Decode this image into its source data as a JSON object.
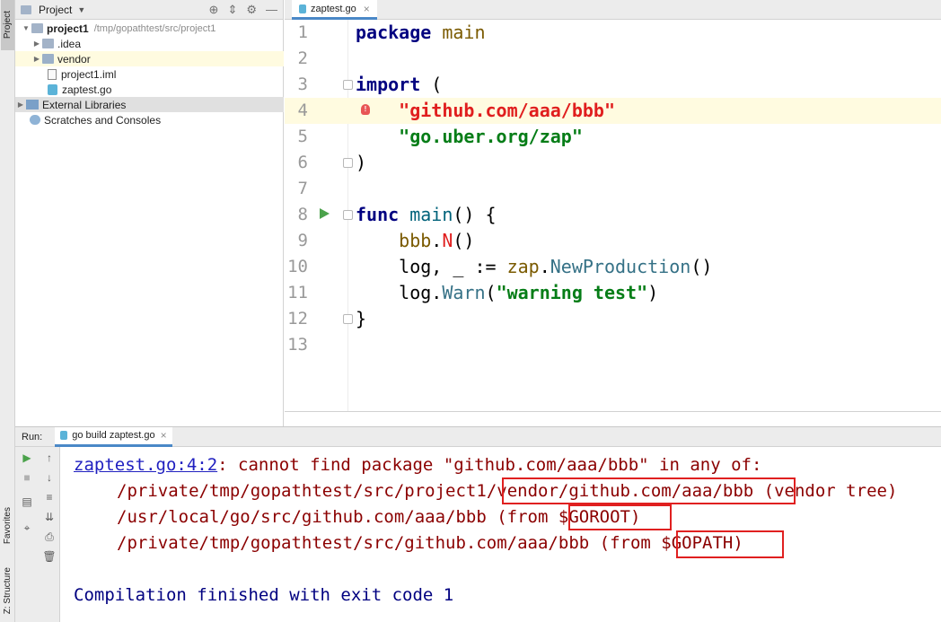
{
  "left_strip": {
    "project_tab": "Project",
    "favorites_tab": "Favorites",
    "structure_tab": "Z: Structure"
  },
  "project_panel": {
    "title": "Project",
    "tree": {
      "root_name": "project1",
      "root_path": "/tmp/gopathtest/src/project1",
      "idea": ".idea",
      "vendor": "vendor",
      "iml": "project1.iml",
      "go_file": "zaptest.go",
      "external_libraries": "External Libraries",
      "scratches": "Scratches and Consoles"
    }
  },
  "editor": {
    "tab_label": "zaptest.go",
    "line_numbers": [
      "1",
      "2",
      "3",
      "4",
      "5",
      "6",
      "7",
      "8",
      "9",
      "10",
      "11",
      "12",
      "13"
    ],
    "code": {
      "l1_kw": "package",
      "l1_name": "main",
      "l3_kw": "import",
      "l3_paren": " (",
      "l4_str": "\"github.com/aaa/bbb\"",
      "l5_str": "\"go.uber.org/zap\"",
      "l6": ")",
      "l8_kw": "func",
      "l8_name": "main",
      "l8_rest": "() {",
      "l9_pkg": "bbb",
      "l9_dot": ".",
      "l9_fn": "N",
      "l9_rest": "()",
      "l10_pre": "log, _ := ",
      "l10_pkg": "zap",
      "l10_dot": ".",
      "l10_fn": "NewProduction",
      "l10_rest": "()",
      "l11_pre": "log.",
      "l11_fn": "Warn",
      "l11_open": "(",
      "l11_str": "\"warning test\"",
      "l11_close": ")",
      "l12": "}"
    }
  },
  "run_panel": {
    "label": "Run:",
    "tab_label": "go build zaptest.go",
    "console": {
      "link": "zaptest.go:4:2",
      "msg": ": cannot find package \"github.com/aaa/bbb\" in any of:",
      "p1_a": "/private/tmp/gopathtest/src/project1",
      "p1_b": "/vendor/github.com/aaa/bbb",
      "p1_c": " (vendor tree)",
      "p2_a": "/usr/local/go/src/github.com/aaa/bbb (from ",
      "p2_b": "$GOROOT)",
      "p3_a": "/private/tmp/gopathtest/src/github.com/aaa/bbb (from ",
      "p3_b": "$GOPATH)",
      "done": "Compilation finished with exit code 1"
    }
  },
  "colors": {
    "keyword": "#000080",
    "string": "#067d17",
    "error": "#e01e1e",
    "console_error": "#8b0000",
    "highlight_line": "#fffbe0",
    "tab_underline": "#4a88c7"
  },
  "icons": [
    "folder-icon",
    "go-file-icon",
    "module-icon",
    "run-icon",
    "stop-icon",
    "rerun-icon",
    "scroll-icon",
    "print-icon",
    "trash-icon",
    "gear-icon",
    "collapse-icon",
    "target-icon",
    "error-bulb-icon"
  ]
}
